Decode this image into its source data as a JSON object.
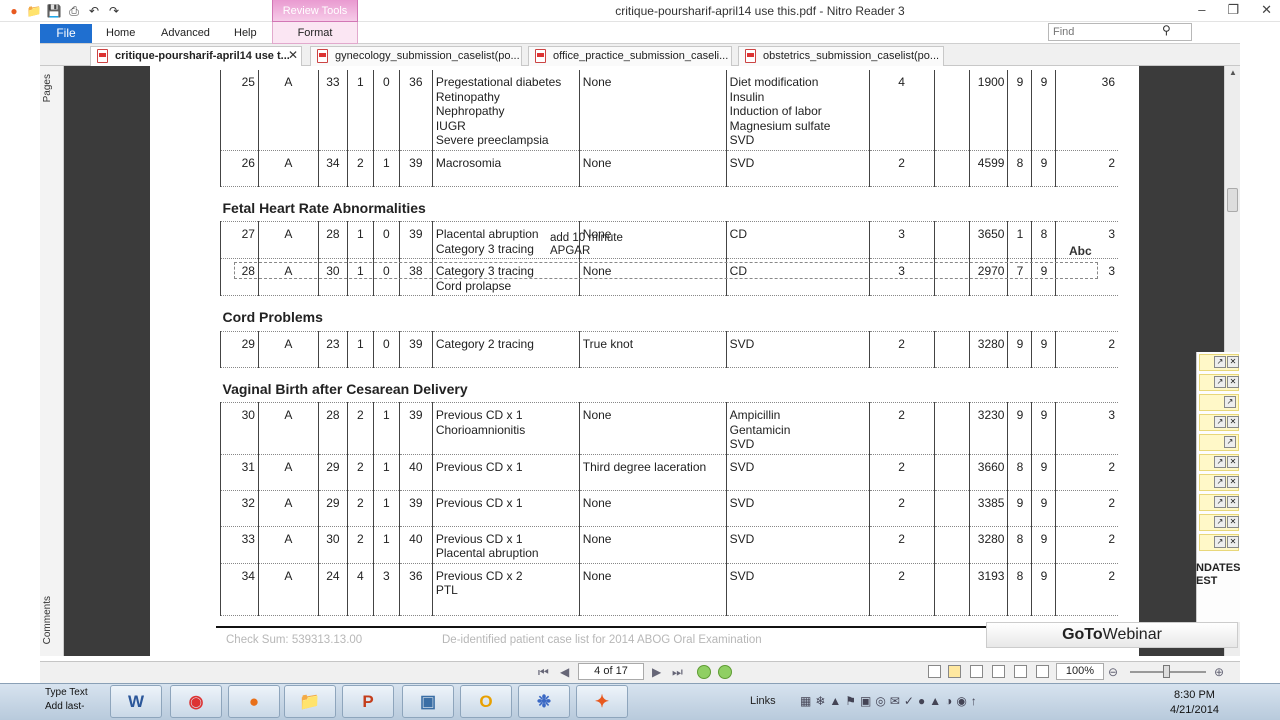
{
  "window": {
    "title": "critique-poursharif-april14 use this.pdf - Nitro Reader 3",
    "contextual_tab": "Review Tools"
  },
  "ribbon": {
    "file": "File",
    "tabs": [
      "Home",
      "Advanced",
      "Help"
    ],
    "format_tab": "Format"
  },
  "search": {
    "placeholder": "Find"
  },
  "doc_tabs": [
    {
      "label": "critique-poursharif-april14 use t..."
    },
    {
      "label": "gynecology_submission_caselist(po..."
    },
    {
      "label": "office_practice_submission_caseli..."
    },
    {
      "label": "obstetrics_submission_caselist(po..."
    }
  ],
  "side_panel": {
    "pages": "Pages",
    "comments": "Comments"
  },
  "sections": {
    "fhr": "Fetal Heart Rate Abnormalities",
    "cord": "Cord Problems",
    "vbac": "Vaginal Birth after Cesarean Delivery"
  },
  "rows": [
    {
      "num": "25",
      "cls": "A",
      "age": "33",
      "g": "1",
      "p": "0",
      "ga": "36",
      "diag": "Pregestational diabetes\nRetinopathy\nNephropathy\nIUGR\nSevere preeclampsia",
      "comp": "None",
      "mgmt": "Diet modification\nInsulin\nInduction of labor\nMagnesium sulfate\nSVD",
      "los": "4",
      "wt": "1900",
      "a1": "9",
      "a5": "9",
      "last": "36"
    },
    {
      "num": "26",
      "cls": "A",
      "age": "34",
      "g": "2",
      "p": "1",
      "ga": "39",
      "diag": "Macrosomia",
      "comp": "None",
      "mgmt": "SVD",
      "los": "2",
      "wt": "4599",
      "a1": "8",
      "a5": "9",
      "last": "2"
    },
    {
      "num": "27",
      "cls": "A",
      "age": "28",
      "g": "1",
      "p": "0",
      "ga": "39",
      "diag": "Placental abruption\nCategory 3 tracing",
      "comp": "None",
      "mgmt": "CD",
      "los": "3",
      "wt": "3650",
      "a1": "1",
      "a5": "8",
      "last": "3"
    },
    {
      "num": "28",
      "cls": "A",
      "age": "30",
      "g": "1",
      "p": "0",
      "ga": "38",
      "diag": "Category 3 tracing\nCord prolapse",
      "comp": "None",
      "mgmt": "CD",
      "los": "3",
      "wt": "2970",
      "a1": "7",
      "a5": "9",
      "last": "3"
    },
    {
      "num": "29",
      "cls": "A",
      "age": "23",
      "g": "1",
      "p": "0",
      "ga": "39",
      "diag": "Category 2 tracing",
      "comp": "True knot",
      "mgmt": "SVD",
      "los": "2",
      "wt": "3280",
      "a1": "9",
      "a5": "9",
      "last": "2"
    },
    {
      "num": "30",
      "cls": "A",
      "age": "28",
      "g": "2",
      "p": "1",
      "ga": "39",
      "diag": "Previous CD x 1\nChorioamnionitis",
      "comp": "None",
      "mgmt": "Ampicillin\nGentamicin\nSVD",
      "los": "2",
      "wt": "3230",
      "a1": "9",
      "a5": "9",
      "last": "3"
    },
    {
      "num": "31",
      "cls": "A",
      "age": "29",
      "g": "2",
      "p": "1",
      "ga": "40",
      "diag": "Previous CD x 1",
      "comp": "Third degree laceration",
      "mgmt": "SVD",
      "los": "2",
      "wt": "3660",
      "a1": "8",
      "a5": "9",
      "last": "2"
    },
    {
      "num": "32",
      "cls": "A",
      "age": "29",
      "g": "2",
      "p": "1",
      "ga": "39",
      "diag": "Previous CD x 1",
      "comp": "None",
      "mgmt": "SVD",
      "los": "2",
      "wt": "3385",
      "a1": "9",
      "a5": "9",
      "last": "2"
    },
    {
      "num": "33",
      "cls": "A",
      "age": "30",
      "g": "2",
      "p": "1",
      "ga": "40",
      "diag": "Previous CD x 1\nPlacental abruption",
      "comp": "None",
      "mgmt": "SVD",
      "los": "2",
      "wt": "3280",
      "a1": "8",
      "a5": "9",
      "last": "2"
    },
    {
      "num": "34",
      "cls": "A",
      "age": "24",
      "g": "4",
      "p": "3",
      "ga": "36",
      "diag": "Previous CD x 2\nPTL",
      "comp": "None",
      "mgmt": "SVD",
      "los": "2",
      "wt": "3193",
      "a1": "8",
      "a5": "9",
      "last": "2"
    }
  ],
  "annotation": {
    "sticky": "add 10 minute\nAPGAR",
    "cursor": "Abc"
  },
  "footer": {
    "checksum": "Check Sum: 539313.13.00",
    "note": "De-identified patient case list for 2014 ABOG Oral Examination"
  },
  "status": {
    "page": "4 of 17",
    "zoom": "100%"
  },
  "goto": {
    "bold": "GoTo",
    "thin": "Webinar",
    "side_text": "NDATES\nEST"
  },
  "taskbar": {
    "type_text": "Type Text\nAdd last-",
    "links": "Links",
    "time": "8:30 PM",
    "date": "4/21/2014"
  }
}
